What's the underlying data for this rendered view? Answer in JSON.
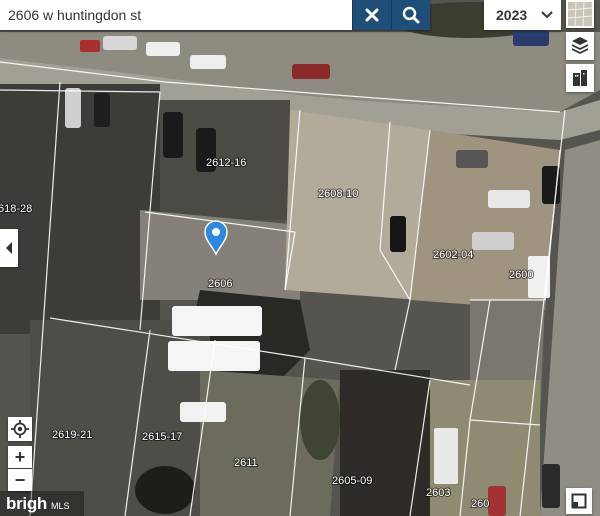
{
  "search": {
    "value": "2606 w huntingdon st",
    "placeholder": ""
  },
  "year_select": {
    "selected": "2023"
  },
  "parcels": [
    "2612-16",
    "2608-10",
    "2606",
    "2602-04",
    "2600",
    "618-28",
    "2619-21",
    "2615-17",
    "2611",
    "2605-09",
    "2603",
    "260"
  ],
  "map_controls": {
    "zoom_in": "+",
    "zoom_out": "−"
  },
  "logo": {
    "text": "brigh",
    "suffix": "MLS"
  },
  "colors": {
    "accent": "#1f4e79",
    "pin": "#2e86de",
    "parcel_line": "#ffffff"
  },
  "icons": {
    "clear": "close-icon",
    "search": "search-icon",
    "basemap": "satellite-icon",
    "layers_2d": "parcel-layer-icon",
    "layers_3d": "buildings-icon",
    "collapse": "chevron-left-icon",
    "locate": "locate-icon",
    "expand": "expand-icon"
  }
}
